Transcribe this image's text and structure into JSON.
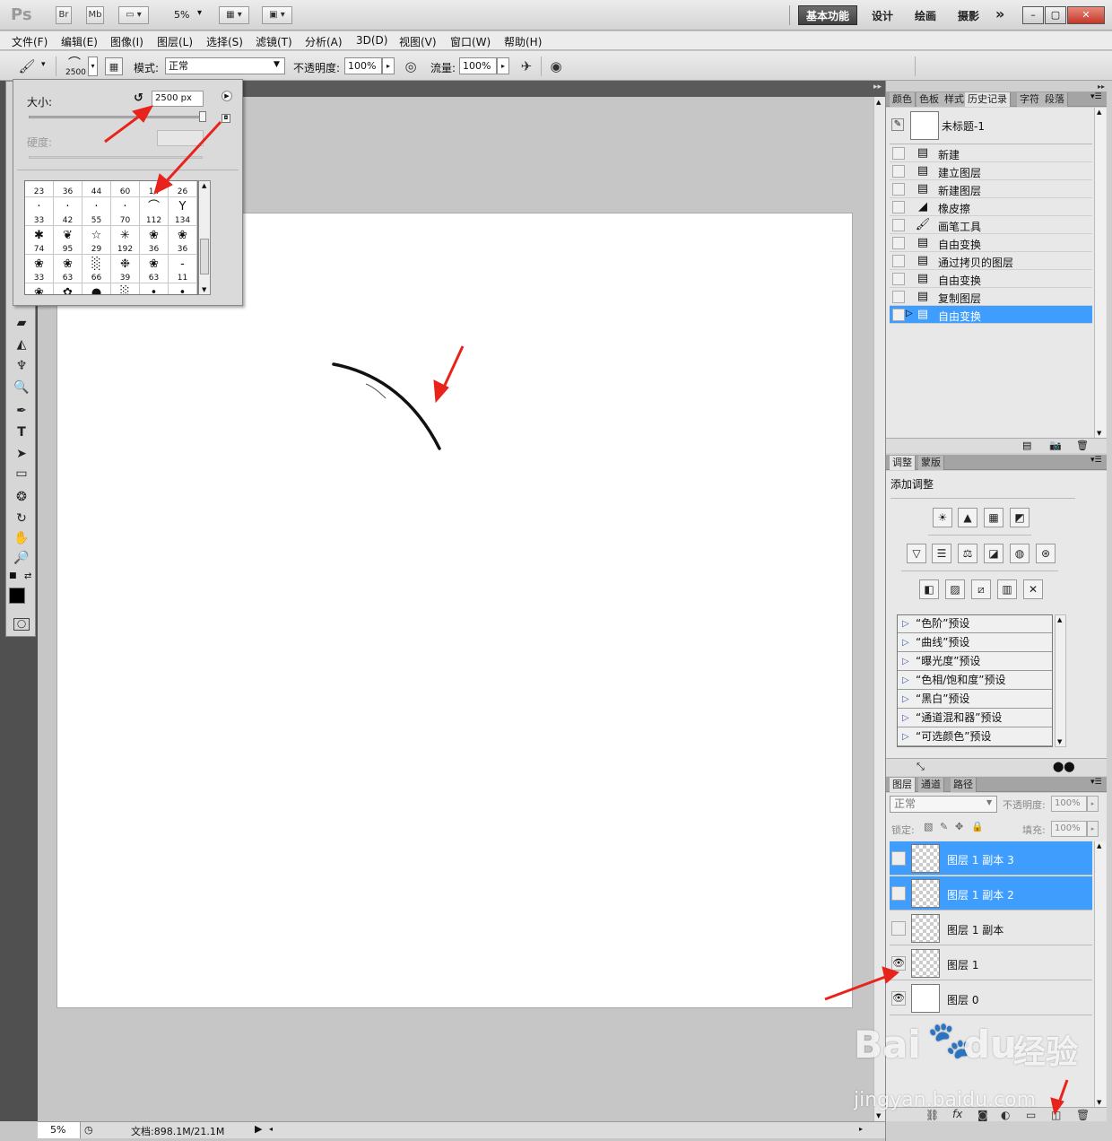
{
  "app": {
    "logo": "Ps",
    "bridge_btn": "Br",
    "minibridge_btn": "Mb",
    "zoom": "5%",
    "workspaces": [
      "设计",
      "绘画",
      "摄影"
    ],
    "active_workspace": "基本功能",
    "more": "»"
  },
  "menu": [
    "文件(F)",
    "编辑(E)",
    "图像(I)",
    "图层(L)",
    "选择(S)",
    "滤镜(T)",
    "分析(A)",
    "3D(D)",
    "视图(V)",
    "窗口(W)",
    "帮助(H)"
  ],
  "options": {
    "brush_size": "2500",
    "mode_label": "模式:",
    "mode_value": "正常",
    "opacity_label": "不透明度:",
    "opacity_value": "100%",
    "flow_label": "流量:",
    "flow_value": "100%"
  },
  "brush_popup": {
    "size_label": "大小:",
    "size_value": "2500 px",
    "hardness_label": "硬度:",
    "brushes": [
      {
        "g": "",
        "s": "23"
      },
      {
        "g": "",
        "s": "36"
      },
      {
        "g": "",
        "s": "44"
      },
      {
        "g": "",
        "s": "60"
      },
      {
        "g": "",
        "s": "14"
      },
      {
        "g": "",
        "s": "26"
      },
      {
        "g": "·",
        "s": "33"
      },
      {
        "g": "·",
        "s": "42"
      },
      {
        "g": "·",
        "s": "55"
      },
      {
        "g": "·",
        "s": "70"
      },
      {
        "g": "⌒",
        "s": "112"
      },
      {
        "g": "Y",
        "s": "134"
      },
      {
        "g": "✱",
        "s": "74"
      },
      {
        "g": "❦",
        "s": "95"
      },
      {
        "g": "☆",
        "s": "29"
      },
      {
        "g": "✳",
        "s": "192"
      },
      {
        "g": "❀",
        "s": "36"
      },
      {
        "g": "❀",
        "s": "36"
      },
      {
        "g": "❀",
        "s": "33"
      },
      {
        "g": "❀",
        "s": "63"
      },
      {
        "g": "░",
        "s": "66"
      },
      {
        "g": "❉",
        "s": "39"
      },
      {
        "g": "❀",
        "s": "63"
      },
      {
        "g": "-",
        "s": "11"
      },
      {
        "g": "❀",
        "s": ""
      },
      {
        "g": "✿",
        "s": ""
      },
      {
        "g": "●",
        "s": ""
      },
      {
        "g": "░",
        "s": ""
      },
      {
        "g": "•",
        "s": ""
      },
      {
        "g": "•",
        "s": ""
      }
    ]
  },
  "history_panel": {
    "tabs": [
      "颜色",
      "色板",
      "样式",
      "历史记录",
      "字符",
      "段落"
    ],
    "active_tab": "历史记录",
    "snapshot": "未标题-1",
    "items": [
      {
        "icon": "doc-icon",
        "label": "新建"
      },
      {
        "icon": "doc-icon",
        "label": "建立图层"
      },
      {
        "icon": "doc-icon",
        "label": "新建图层"
      },
      {
        "icon": "eraser-icon",
        "label": "橡皮擦"
      },
      {
        "icon": "brush-icon",
        "label": "画笔工具"
      },
      {
        "icon": "doc-icon",
        "label": "自由变换"
      },
      {
        "icon": "doc-icon",
        "label": "通过拷贝的图层"
      },
      {
        "icon": "doc-icon",
        "label": "自由变换"
      },
      {
        "icon": "doc-icon",
        "label": "复制图层"
      },
      {
        "icon": "doc-icon",
        "label": "自由变换"
      }
    ],
    "selected_index": 9
  },
  "adjust_panel": {
    "tabs": [
      "调整",
      "蒙版"
    ],
    "heading": "添加调整",
    "presets": [
      "“色阶”预设",
      "“曲线”预设",
      "“曝光度”预设",
      "“色相/饱和度”预设",
      "“黑白”预设",
      "“通道混和器”预设",
      "“可选颜色”预设"
    ]
  },
  "layers_panel": {
    "tabs": [
      "图层",
      "通道",
      "路径"
    ],
    "blend_mode": "正常",
    "opacity_label": "不透明度:",
    "opacity_value": "100%",
    "lock_label": "锁定:",
    "fill_label": "填充:",
    "fill_value": "100%",
    "layers": [
      {
        "name": "图层 1 副本 3",
        "visible": false,
        "selected": true
      },
      {
        "name": "图层 1 副本 2",
        "visible": false,
        "selected": true
      },
      {
        "name": "图层 1 副本",
        "visible": false,
        "selected": false
      },
      {
        "name": "图层 1",
        "visible": true,
        "selected": false
      },
      {
        "name": "图层 0",
        "visible": true,
        "selected": false
      }
    ]
  },
  "status": {
    "zoom": "5%",
    "doc_info": "文档:898.1M/21.1M"
  },
  "watermark": {
    "brand": "Bai",
    "brand2": "du",
    "brand_cn": "经验",
    "url": "jingyan.baidu.com"
  },
  "colors": {
    "selection": "#3e9dfd",
    "annotation_arrow": "#e8231b"
  }
}
